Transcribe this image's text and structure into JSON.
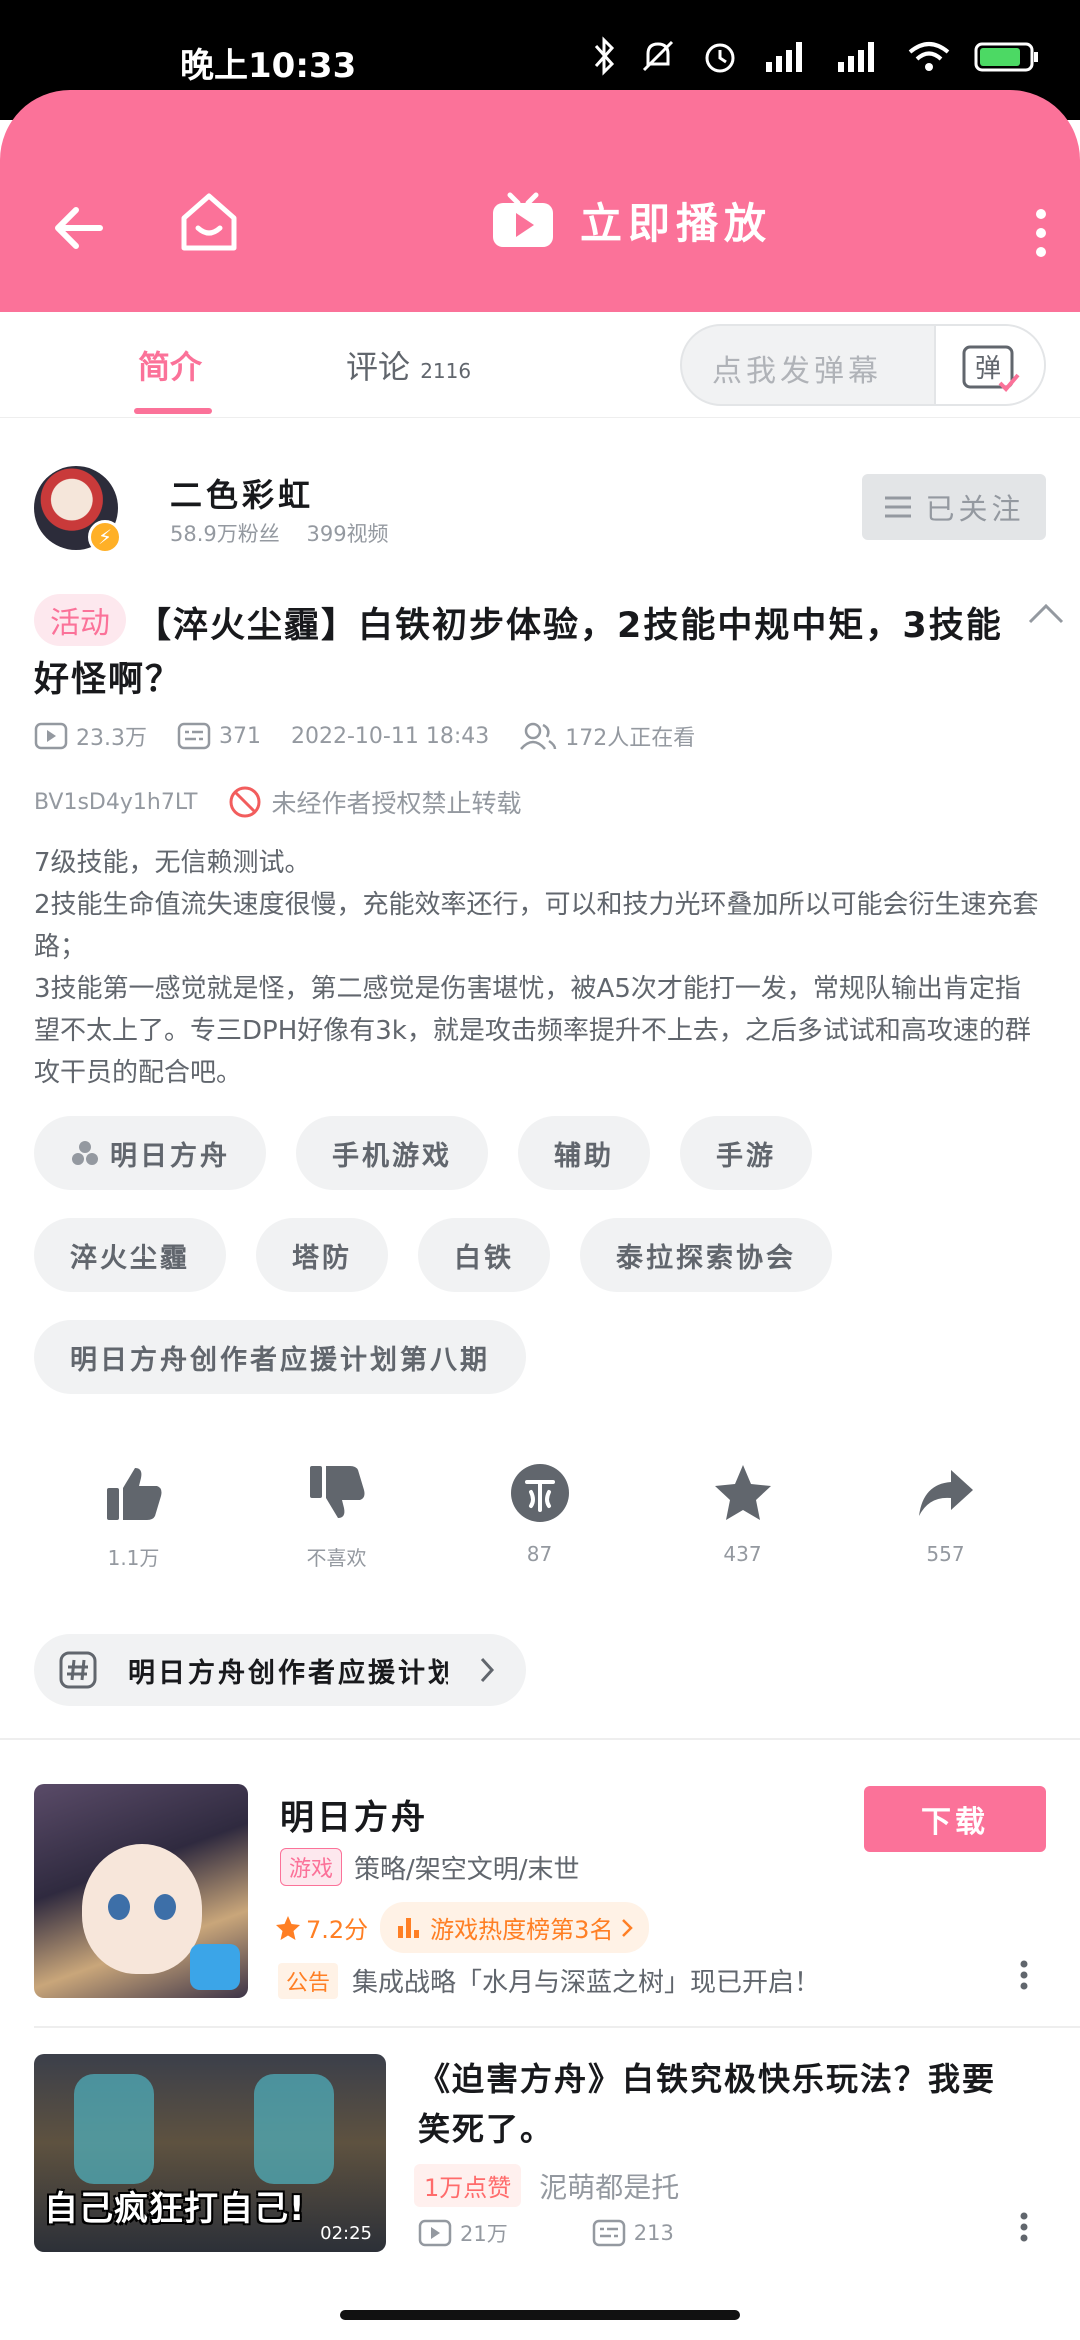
{
  "status_bar": {
    "time": "晚上10:33"
  },
  "header": {
    "play_label": "立即播放"
  },
  "tabs": [
    {
      "label": "简介"
    },
    {
      "label": "评论",
      "count": "2116"
    }
  ],
  "danmaku": {
    "placeholder": "点我发弹幕",
    "button_label": "弹"
  },
  "uploader": {
    "name": "二色彩虹",
    "fans": "58.9万粉丝",
    "videos": "399视频",
    "follow_label": "已关注"
  },
  "video": {
    "activity_tag": "活动",
    "title": "【淬火尘霾】白铁初步体验，2技能中规中矩，3技能好怪啊？",
    "plays": "23.3万",
    "danmaku_count": "371",
    "date": "2022-10-11 18:43",
    "watching": "172人正在看",
    "bvid": "BV1sD4y1h7LT",
    "copyright": "未经作者授权禁止转载",
    "description": [
      "7级技能，无信赖测试。",
      "2技能生命值流失速度很慢，充能效率还行，可以和技力光环叠加所以可能会衍生速充套路；",
      "3技能第一感觉就是怪，第二感觉是伤害堪忧，被A5次才能打一发，常规队输出肯定指望不太上了。专三DPH好像有3k，就是攻击频率提升不上去，之后多试试和高攻速的群攻干员的配合吧。"
    ]
  },
  "tags": [
    [
      "明日方舟",
      "手机游戏",
      "辅助",
      "手游"
    ],
    [
      "淬火尘霾",
      "塔防",
      "白铁",
      "泰拉探索协会"
    ],
    [
      "明日方舟创作者应援计划第八期"
    ]
  ],
  "actions": [
    {
      "name": "like",
      "count": "1.1万"
    },
    {
      "name": "dislike",
      "count": "不喜欢"
    },
    {
      "name": "coin",
      "count": "87"
    },
    {
      "name": "favorite",
      "count": "437"
    },
    {
      "name": "share",
      "count": "557"
    }
  ],
  "topic": {
    "label": "明日方舟创作者应援计划第八期"
  },
  "game": {
    "name": "明日方舟",
    "type_tag": "游戏",
    "genres": "策略/架空文明/末世",
    "rating": "7.2分",
    "rank": "游戏热度榜第3名",
    "notice_tag": "公告",
    "notice": "集成战略「水月与深蓝之树」现已开启！",
    "download_label": "下载"
  },
  "recommend": {
    "title": "《迫害方舟》白铁究极快乐玩法？我要笑死了。",
    "cover_caption": "自己疯狂打自己!",
    "duration": "02:25",
    "likes_tag": "1万点赞",
    "author": "泥萌都是托",
    "plays": "21万",
    "danmaku": "213"
  },
  "colors": {
    "brand_pink": "#fb7299",
    "orange": "#ff7f24",
    "gray_text": "#9499a0"
  }
}
